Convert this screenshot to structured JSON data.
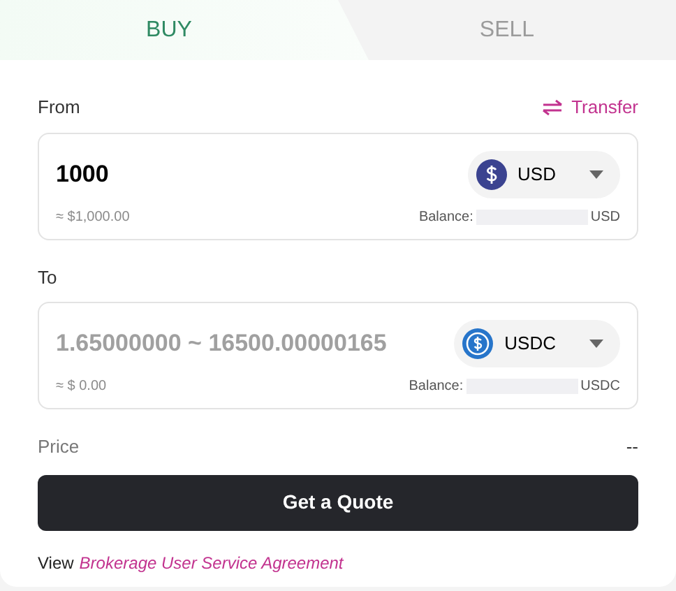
{
  "tabs": [
    {
      "label": "BUY",
      "selected": true
    },
    {
      "label": "SELL",
      "selected": false
    }
  ],
  "from": {
    "label": "From",
    "transfer": "Transfer",
    "amount": "1000",
    "currency": "USD",
    "kind": "solid",
    "approx": "≈ $1,000.00",
    "balance_label": "Balance:",
    "balance_unit": "USD"
  },
  "to": {
    "label": "To",
    "placeholder": "1.65000000 ~ 16500.00000165",
    "currency": "USDC",
    "kind": "ring",
    "approx": "≈ $ 0.00",
    "balance_label": "Balance:",
    "balance_unit": "USDC"
  },
  "price": {
    "label": "Price",
    "value": "--"
  },
  "quote_button": "Get a Quote",
  "footer": {
    "prefix": "View",
    "link": "Brokerage User Service Agreement"
  }
}
